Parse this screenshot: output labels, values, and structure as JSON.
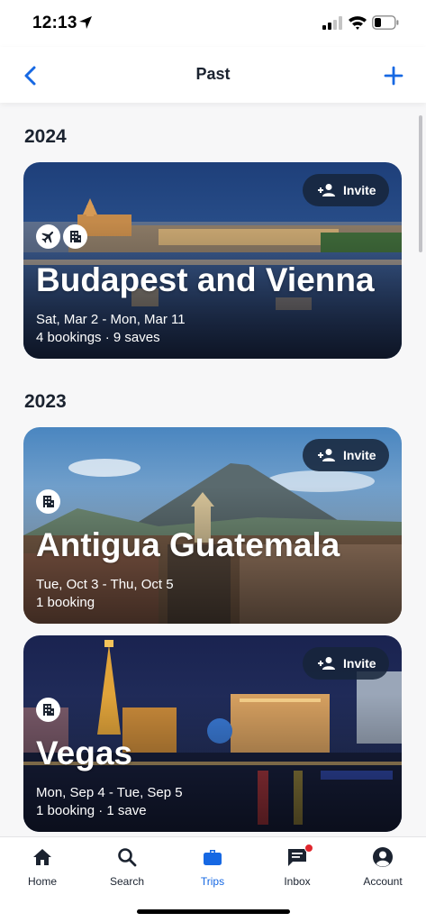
{
  "status_bar": {
    "time": "12:13"
  },
  "nav": {
    "title": "Past"
  },
  "sections": [
    {
      "year": "2024",
      "trips": [
        {
          "title": "Budapest and Vienna",
          "dates": "Sat, Mar 2 - Mon, Mar 11",
          "meta": "4 bookings · 9 saves",
          "invite_label": "Invite",
          "badges": [
            "plane-icon",
            "hotel-icon"
          ]
        }
      ]
    },
    {
      "year": "2023",
      "trips": [
        {
          "title": "Antigua Guatemala",
          "dates": "Tue, Oct 3 - Thu, Oct 5",
          "meta": "1 booking",
          "invite_label": "Invite",
          "badges": [
            "hotel-icon"
          ]
        },
        {
          "title": "Vegas",
          "dates": "Mon, Sep 4 - Tue, Sep 5",
          "meta": "1 booking · 1 save",
          "invite_label": "Invite",
          "badges": [
            "hotel-icon"
          ]
        }
      ]
    }
  ],
  "tab_bar": {
    "tabs": [
      {
        "label": "Home",
        "icon": "home-icon"
      },
      {
        "label": "Search",
        "icon": "search-icon"
      },
      {
        "label": "Trips",
        "icon": "suitcase-icon",
        "active": true
      },
      {
        "label": "Inbox",
        "icon": "inbox-icon",
        "badge": true
      },
      {
        "label": "Account",
        "icon": "account-icon"
      }
    ]
  },
  "colors": {
    "accent": "#1668e3",
    "text": "#1b2330",
    "invite_bg": "#16243a",
    "notification": "#e0262d"
  }
}
